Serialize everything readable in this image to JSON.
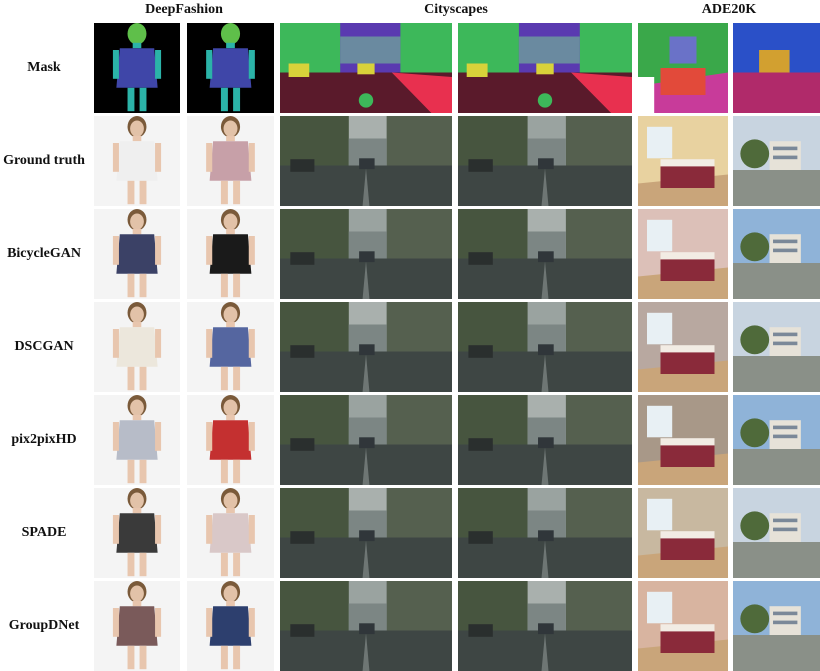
{
  "column_headers": [
    "DeepFashion",
    "Cityscapes",
    "ADE20K"
  ],
  "row_labels": [
    "Mask",
    "Ground truth",
    "BicycleGAN",
    "DSCGAN",
    "pix2pixHD",
    "SPADE",
    "GroupDNet"
  ],
  "palette": {
    "fashion_bg": "#f4f4f4",
    "mask_bg": "#000000",
    "mask_person_top": "#3f46a8",
    "mask_person_head": "#5fbf4a",
    "mask_person_skin": "#2bb3a8",
    "street_sky": "#9aa3a0",
    "street_road": "#3e4644",
    "street_trees": "#47553f",
    "city_mask_road": "#5a1a2b",
    "city_mask_sidewalk": "#e8304f",
    "city_mask_veg": "#3db85a",
    "city_mask_building": "#5a3ab0",
    "city_mask_car": "#d8d23a",
    "ade_mask_wall": "#3aa84a",
    "ade_mask_floor": "#c83b9a",
    "ade_mask_sky": "#2a50c8",
    "room_warm": "#c9a57a",
    "outdoor_sky": "#8fb3d8"
  },
  "rows": [
    {
      "dress_colors": [
        "#3f46a8",
        "#3f46a8"
      ]
    },
    {
      "dress_colors": [
        "#efefef",
        "#c7a0a8"
      ]
    },
    {
      "dress_colors": [
        "#3b4166",
        "#1a1a1a"
      ]
    },
    {
      "dress_colors": [
        "#ece7dc",
        "#5566a0"
      ]
    },
    {
      "dress_colors": [
        "#b7bcc8",
        "#c43030"
      ]
    },
    {
      "dress_colors": [
        "#3a3a3a",
        "#d9c8c8"
      ]
    },
    {
      "dress_colors": [
        "#7a5a5a",
        "#2d3f6e"
      ]
    }
  ]
}
